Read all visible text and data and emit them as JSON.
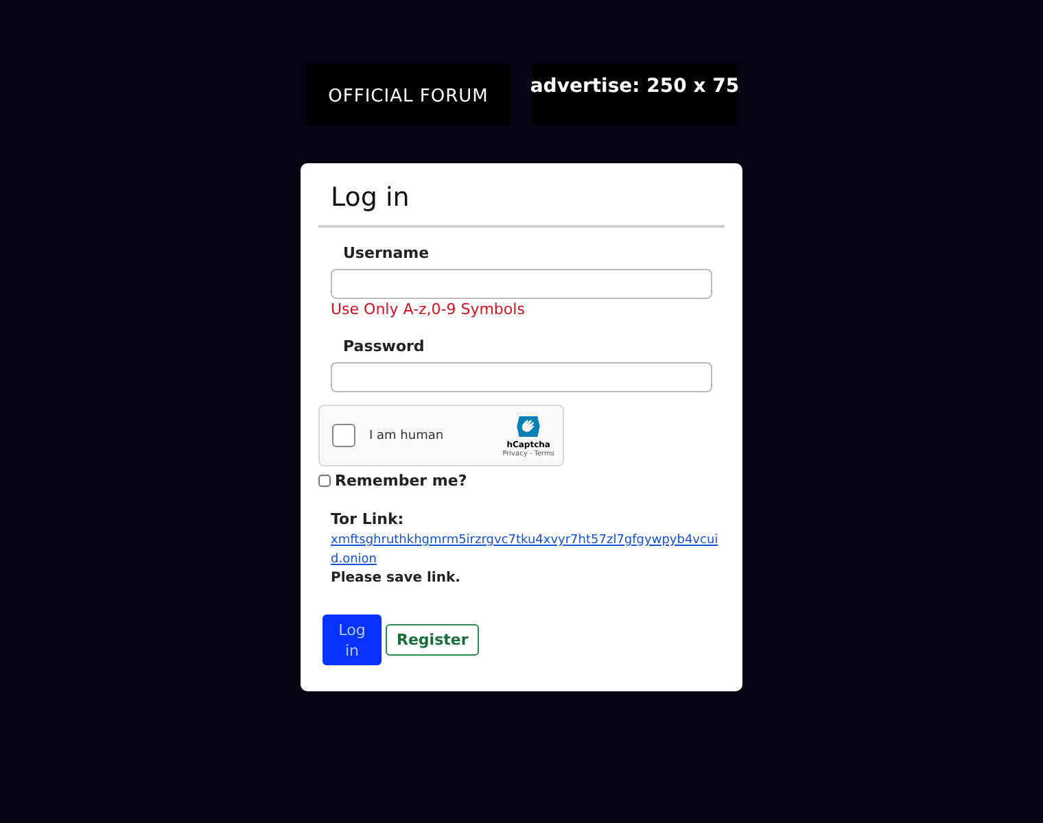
{
  "banners": [
    {
      "kind": "logo",
      "text": "OFFICIAL FORUM"
    },
    {
      "kind": "ad",
      "text": "advertise: 250 x 75"
    }
  ],
  "form": {
    "title": "Log in",
    "fields": [
      {
        "label": "Username",
        "hint": "Use Only A-z,0-9 Symbols"
      },
      {
        "label": "Password"
      }
    ],
    "captcha": {
      "label": "I am human",
      "checked": false,
      "brand": "hCaptcha",
      "links": "Privacy - Terms"
    },
    "remember": {
      "label": "Remember me?",
      "checked": false
    },
    "tor": {
      "heading": "Tor Link:",
      "link": "xmftsghruthkhgmrm5irzrgvc7tku4xvyr7ht57zl7gfgywpyb4vcuid.onion ",
      "note": "Please save link."
    },
    "buttons": [
      {
        "kind": "primary",
        "label": "Log in"
      },
      {
        "kind": "outline",
        "label": "Register"
      }
    ]
  }
}
